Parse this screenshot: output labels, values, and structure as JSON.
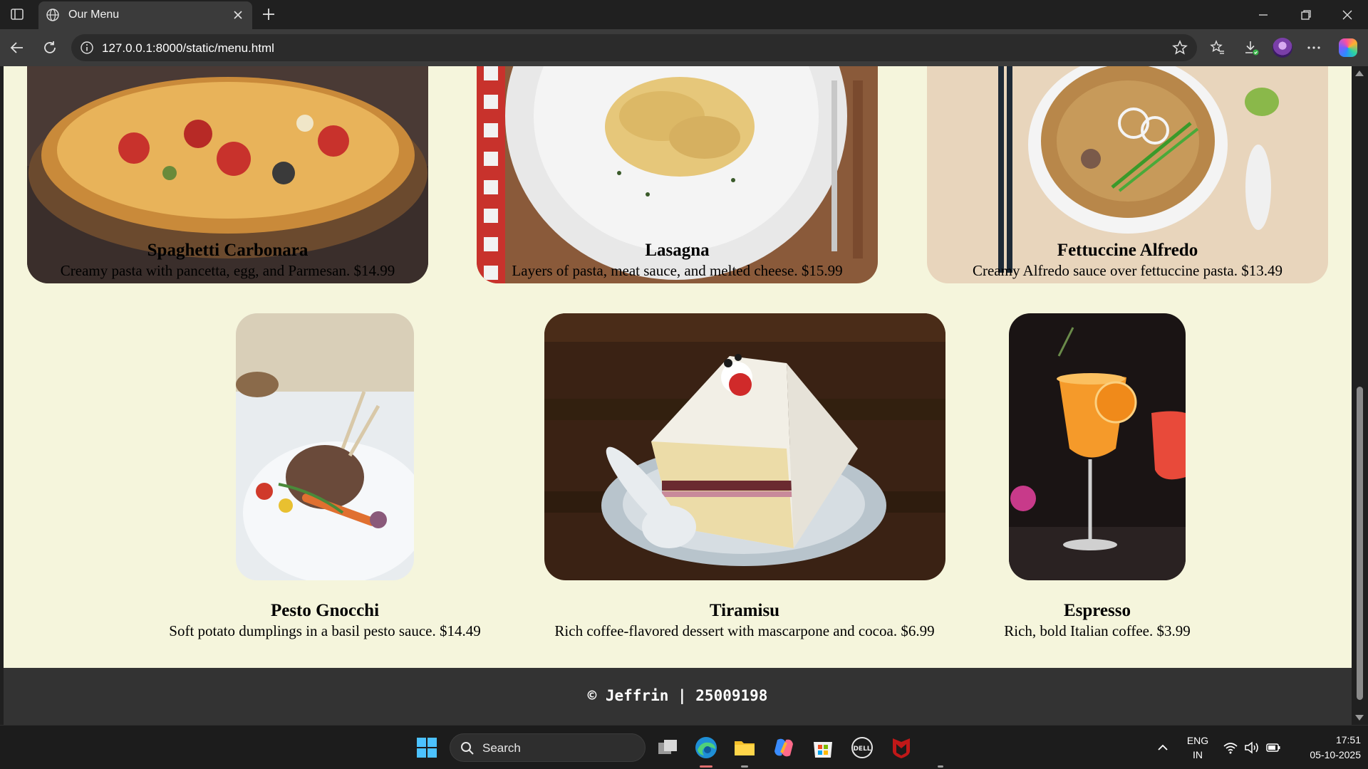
{
  "browser": {
    "tab_title": "Our Menu",
    "url": "127.0.0.1:8000/static/menu.html"
  },
  "menu": {
    "row1": [
      {
        "name": "Spaghetti Carbonara",
        "description": "Creamy pasta with pancetta, egg, and Parmesan. $14.99",
        "image_icon": "pizza-photo"
      },
      {
        "name": "Lasagna",
        "description": "Layers of pasta, meat sauce, and melted cheese. $15.99",
        "image_icon": "penne-pasta-photo"
      },
      {
        "name": "Fettuccine Alfredo",
        "description": "Creamy Alfredo sauce over fettuccine pasta. $13.49",
        "image_icon": "noodle-soup-photo"
      }
    ],
    "row2": [
      {
        "name": "Pesto Gnocchi",
        "description": "Soft potato dumplings in a basil pesto sauce. $14.49",
        "image_icon": "lamb-chop-plate-photo"
      },
      {
        "name": "Tiramisu",
        "description": "Rich coffee-flavored dessert with mascarpone and cocoa. $6.99",
        "image_icon": "layer-cake-photo"
      },
      {
        "name": "Espresso",
        "description": "Rich, bold Italian coffee. $3.99",
        "image_icon": "orange-cocktail-photo"
      }
    ]
  },
  "footer": {
    "text": "© Jeffrin | 25009198"
  },
  "taskbar": {
    "search_placeholder": "Search",
    "language": "ENG",
    "region": "IN",
    "time": "17:51",
    "date": "05-10-2025"
  },
  "colors": {
    "page_background": "#f5f5dc",
    "footer_background": "#333333",
    "browser_chrome": "#3b3b3b"
  }
}
